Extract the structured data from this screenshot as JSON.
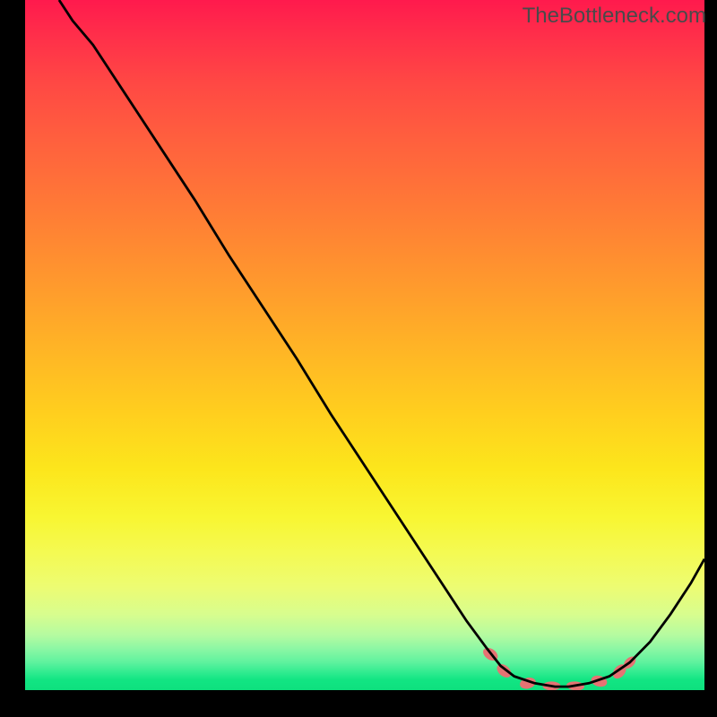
{
  "watermark": "TheBottleneck.com",
  "chart_data": {
    "type": "line",
    "title": "",
    "xlabel": "",
    "ylabel": "",
    "xlim": [
      0,
      100
    ],
    "ylim": [
      0,
      100
    ],
    "curve": {
      "name": "bottleneck-curve",
      "points": [
        {
          "x": 5,
          "y": 100
        },
        {
          "x": 7,
          "y": 97
        },
        {
          "x": 10,
          "y": 93.5
        },
        {
          "x": 15,
          "y": 86
        },
        {
          "x": 20,
          "y": 78.5
        },
        {
          "x": 25,
          "y": 71
        },
        {
          "x": 30,
          "y": 63
        },
        {
          "x": 35,
          "y": 55.5
        },
        {
          "x": 40,
          "y": 48
        },
        {
          "x": 45,
          "y": 40
        },
        {
          "x": 50,
          "y": 32.5
        },
        {
          "x": 55,
          "y": 25
        },
        {
          "x": 60,
          "y": 17.5
        },
        {
          "x": 65,
          "y": 10
        },
        {
          "x": 68,
          "y": 6
        },
        {
          "x": 70,
          "y": 3.5
        },
        {
          "x": 72,
          "y": 2
        },
        {
          "x": 75,
          "y": 1
        },
        {
          "x": 78,
          "y": 0.5
        },
        {
          "x": 80,
          "y": 0.5
        },
        {
          "x": 83,
          "y": 1
        },
        {
          "x": 86,
          "y": 2
        },
        {
          "x": 89,
          "y": 4
        },
        {
          "x": 92,
          "y": 7
        },
        {
          "x": 95,
          "y": 11
        },
        {
          "x": 98,
          "y": 15.5
        },
        {
          "x": 100,
          "y": 19
        }
      ]
    },
    "markers": {
      "name": "highlighted-points",
      "color": "#e57373",
      "points": [
        {
          "x": 68.5,
          "y": 5.2,
          "rx": 6,
          "ry": 9,
          "rot": -55
        },
        {
          "x": 70.5,
          "y": 2.8,
          "rx": 6,
          "ry": 9,
          "rot": -50
        },
        {
          "x": 74,
          "y": 1.0,
          "rx": 9,
          "ry": 6,
          "rot": -15
        },
        {
          "x": 77.5,
          "y": 0.6,
          "rx": 10,
          "ry": 5,
          "rot": 0
        },
        {
          "x": 81,
          "y": 0.6,
          "rx": 10,
          "ry": 5,
          "rot": 5
        },
        {
          "x": 84.5,
          "y": 1.3,
          "rx": 9,
          "ry": 6,
          "rot": 15
        },
        {
          "x": 87.5,
          "y": 2.7,
          "rx": 6,
          "ry": 9,
          "rot": 40
        },
        {
          "x": 89,
          "y": 4.0,
          "rx": 5,
          "ry": 8,
          "rot": 45
        }
      ]
    }
  }
}
